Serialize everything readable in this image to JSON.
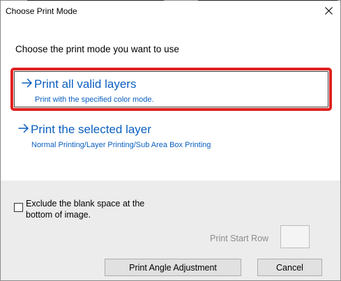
{
  "dialog": {
    "title": "Choose Print Mode",
    "close_icon": "close-icon"
  },
  "prompt": "Choose the print mode you want to use",
  "options": [
    {
      "title": "Print all valid layers",
      "subtitle": "Print with the specified color mode.",
      "selected": true
    },
    {
      "title": "Print the selected layer",
      "subtitle": "Normal Printing/Layer Printing/Sub Area Box Printing",
      "selected": false
    }
  ],
  "exclude_blank": {
    "label": "Exclude the blank space at the bottom of image.",
    "checked": false
  },
  "print_start_row": {
    "label": "Print Start Row",
    "value": "",
    "enabled": false
  },
  "buttons": {
    "angle": "Print Angle Adjustment",
    "cancel": "Cancel"
  },
  "colors": {
    "accent": "#0a5fc0",
    "highlight": "#e0201f",
    "footer": "#ececec"
  }
}
